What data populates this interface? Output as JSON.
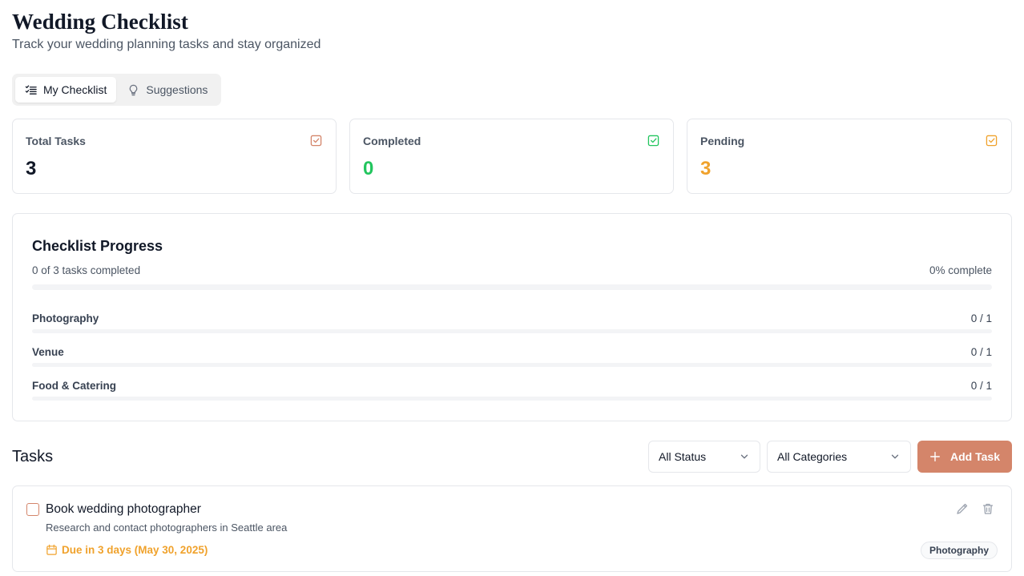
{
  "header": {
    "title": "Wedding Checklist",
    "subtitle": "Track your wedding planning tasks and stay organized"
  },
  "tabs": [
    {
      "label": "My Checklist",
      "icon": "list-check-icon",
      "active": true
    },
    {
      "label": "Suggestions",
      "icon": "lightbulb-icon",
      "active": false
    }
  ],
  "stats": [
    {
      "label": "Total Tasks",
      "value": "3",
      "color": "#111827",
      "icon_color": "#d4856a"
    },
    {
      "label": "Completed",
      "value": "0",
      "color": "#22c55e",
      "icon_color": "#22c55e"
    },
    {
      "label": "Pending",
      "value": "3",
      "color": "#f0a22c",
      "icon_color": "#f0a22c"
    }
  ],
  "progress": {
    "title": "Checklist Progress",
    "summary": "0 of 3 tasks completed",
    "percent_label": "0% complete",
    "percent": 0,
    "categories": [
      {
        "label": "Photography",
        "count": "0 / 1",
        "fraction": 0
      },
      {
        "label": "Venue",
        "count": "0 / 1",
        "fraction": 0
      },
      {
        "label": "Food & Catering",
        "count": "0 / 1",
        "fraction": 0
      }
    ]
  },
  "tasks_section": {
    "title": "Tasks",
    "status_filter": "All Status",
    "category_filter": "All Categories",
    "add_label": "Add Task"
  },
  "tasks": [
    {
      "title": "Book wedding photographer",
      "description": "Research and contact photographers in Seattle area",
      "due": "Due in 3 days (May 30, 2025)",
      "category": "Photography",
      "completed": false
    }
  ],
  "colors": {
    "accent": "#d4856a",
    "success": "#22c55e",
    "warning": "#f0a22c"
  }
}
